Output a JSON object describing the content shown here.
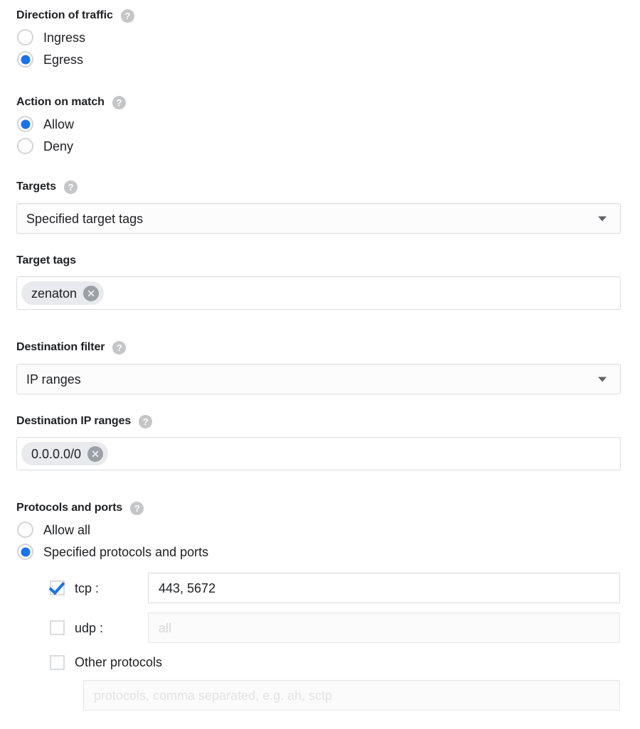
{
  "form": {
    "sections": [
      {
        "id": "direction-of-traffic",
        "label": "Direction of traffic",
        "help_icon": "help-icon",
        "help_glyph": "?",
        "options": [
          {
            "label": "Ingress",
            "selected": false
          },
          {
            "label": "Egress",
            "selected": true
          }
        ]
      },
      {
        "id": "action-on-match",
        "label": "Action on match",
        "help_icon": "help-icon",
        "help_glyph": "?",
        "options": [
          {
            "label": "Allow",
            "selected": true
          },
          {
            "label": "Deny",
            "selected": false
          }
        ]
      },
      {
        "id": "targets",
        "label": "Targets",
        "help_icon": "help-icon",
        "help_glyph": "?",
        "control": "select",
        "value": "Specified target tags",
        "arrow_icon": "chevron-down-icon"
      },
      {
        "id": "target-tags",
        "label": "Target tags",
        "control": "chips",
        "chips": [
          {
            "text": "zenaton",
            "remove_icon": "close-circle-icon",
            "remove_glyph": "✕"
          }
        ]
      },
      {
        "id": "destination-filter",
        "label": "Destination filter",
        "help_icon": "help-icon",
        "help_glyph": "?",
        "control": "select",
        "value": "IP ranges",
        "arrow_icon": "chevron-down-icon"
      },
      {
        "id": "destination-ip-ranges",
        "label": "Destination IP ranges",
        "help_icon": "help-icon",
        "help_glyph": "?",
        "control": "chips",
        "chips": [
          {
            "text": "0.0.0.0/0",
            "remove_icon": "close-circle-icon",
            "remove_glyph": "✕"
          }
        ]
      },
      {
        "id": "protocols-and-ports",
        "label": "Protocols and ports",
        "help_icon": "help-icon",
        "help_glyph": "?",
        "options": [
          {
            "label": "Allow all",
            "selected": false
          },
          {
            "label": "Specified protocols and ports",
            "selected": true
          }
        ],
        "protocols": [
          {
            "id": "tcp",
            "label": "tcp :",
            "checked": true,
            "value": "443, 5672",
            "placeholder": ""
          },
          {
            "id": "udp",
            "label": "udp :",
            "checked": false,
            "value": "",
            "placeholder": "all"
          },
          {
            "id": "other-protocols",
            "label": "Other protocols",
            "checked": false,
            "value": "",
            "placeholder": "protocols, comma separated, e.g. ah, sctp"
          }
        ]
      }
    ]
  },
  "colors": {
    "accent_blue": "#1a73e8",
    "text_primary": "#202124",
    "border": "#dadce0",
    "chip_bg": "#e8eaed",
    "chip_remove_bg": "#9aa0a6",
    "help_icon_bg": "#c4c6c8",
    "placeholder": "#d5d7d9"
  }
}
